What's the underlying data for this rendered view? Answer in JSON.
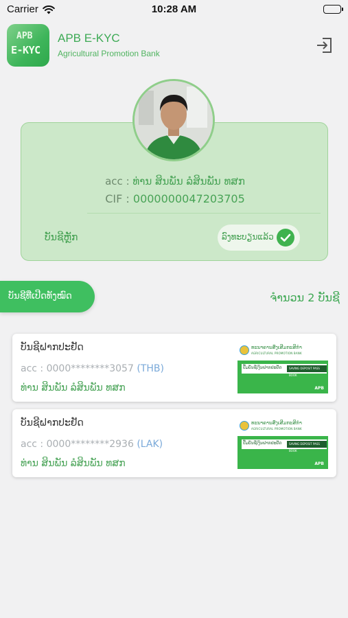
{
  "status_bar": {
    "carrier": "Carrier",
    "time": "10:28 AM"
  },
  "header": {
    "logo_line1": "APB",
    "logo_line2": "E-KYC",
    "title": "APB E-KYC",
    "subtitle": "Agricultural Promotion Bank",
    "logout_icon": "logout-icon"
  },
  "profile": {
    "acc_label": "acc :",
    "acc_name": "ທ່ານ ສິນພັນ  ລໍສິນພັນ ທສກ",
    "cif_label": "CIF :",
    "cif_number": "0000000047203705",
    "main_account_label": "ບັນຊີຫຼັກ",
    "verified_label": "ລົງທະບຽນແລ້ວ",
    "verified_icon": "check-circle-icon"
  },
  "accounts_section": {
    "tab_label": "ບັນຊີທີ່ເປີດທັງໝົດ",
    "count_label": "ຈໍານວນ 2 ບັນຊີ"
  },
  "accounts": [
    {
      "type": "ບັນຊີຝາກປະຢັດ",
      "acc_label": "acc :",
      "number": "0000********3057",
      "currency": "(THB)",
      "holder": "ທ່ານ ສິນພັນ  ລໍສິນພັນ ທສກ"
    },
    {
      "type": "ບັນຊີຝາກປະຢັດ",
      "acc_label": "acc :",
      "number": "0000********2936",
      "currency": "(LAK)",
      "holder": "ທ່ານ ສິນພັນ  ລໍສິນພັນ ທສກ"
    }
  ],
  "passbook": {
    "bank_name_lo": "ທະນາຄານສົ່ງເສີມກະສິກໍາ",
    "bank_name_en": "AGRICULTURAL PROMOTION BANK",
    "book_title_lo": "ປື້ມບັນຊີເງິນຝາກປະຢັດ",
    "book_title_en": "SAVING DEPOSIT PASS BOOK",
    "brand": "APB"
  },
  "colors": {
    "brand_green": "#3fbf60",
    "card_green": "#cce8c9",
    "text_green": "#48a356",
    "currency_blue": "#7aa9d9"
  }
}
